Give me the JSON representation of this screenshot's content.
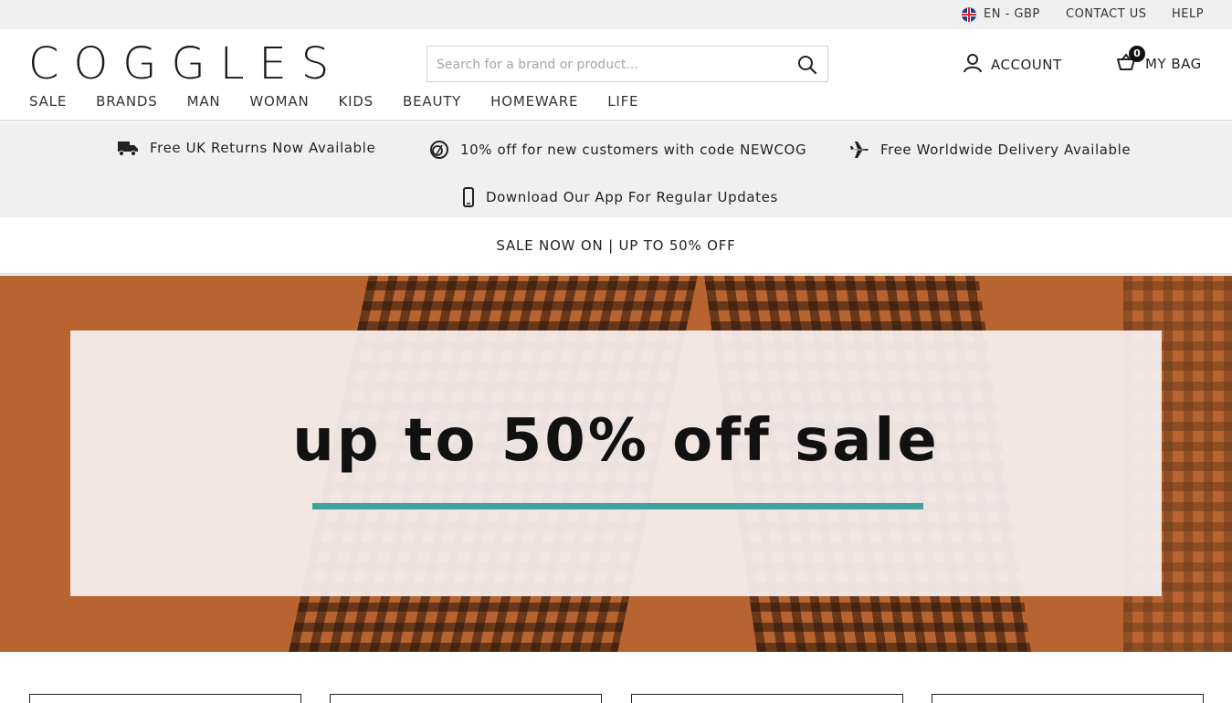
{
  "topbar": {
    "locale": "EN - GBP",
    "contact": "CONTACT US",
    "help": "HELP"
  },
  "header": {
    "logo": "COGGLES",
    "search_placeholder": "Search for a brand or product...",
    "account_label": "ACCOUNT",
    "bag_label": "MY BAG",
    "bag_count": "0"
  },
  "nav": {
    "items": [
      "SALE",
      "BRANDS",
      "MAN",
      "WOMAN",
      "KIDS",
      "BEAUTY",
      "HOMEWARE",
      "LIFE"
    ]
  },
  "usp": {
    "returns": "Free UK Returns Now Available",
    "discount": "10% off for new customers with code NEWCOG",
    "delivery": "Free Worldwide Delivery Available",
    "app": "Download Our App For Regular Updates"
  },
  "promo": {
    "text": "SALE NOW ON | UP TO 50% OFF"
  },
  "hero": {
    "headline": "up to 50% off sale",
    "background_color": "#b86430",
    "accent_color": "#3fa29a"
  },
  "icons": {
    "flag": "uk-flag-icon",
    "search": "search-icon",
    "account": "user-icon",
    "bag": "basket-icon",
    "returns": "truck-icon",
    "discount": "tag-icon",
    "delivery": "plane-icon",
    "app": "phone-icon"
  }
}
